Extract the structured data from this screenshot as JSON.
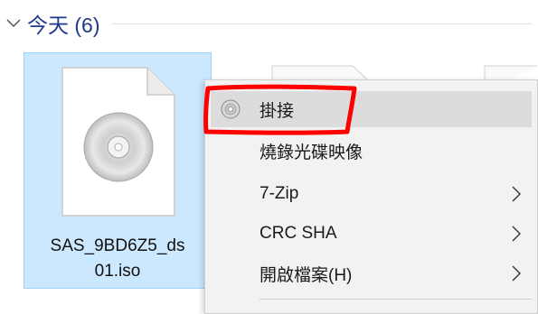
{
  "group": {
    "title": "今天 (6)"
  },
  "file": {
    "name_line1": "SAS_9BD6Z5_ds",
    "name_line2": "01.iso"
  },
  "context_menu": {
    "items": [
      {
        "label": "掛接",
        "icon": "disc-icon",
        "submenu": false,
        "highlighted": true
      },
      {
        "label": "燒錄光碟映像",
        "submenu": false
      },
      {
        "label": "7-Zip",
        "submenu": true
      },
      {
        "label": "CRC SHA",
        "submenu": true
      },
      {
        "label": "開啟檔案(H)",
        "submenu": true
      }
    ]
  },
  "colors": {
    "selection_bg": "#cce8ff",
    "selection_border": "#99d1ff",
    "annotation_red": "#ff0000",
    "group_title": "#1e3a8a"
  }
}
